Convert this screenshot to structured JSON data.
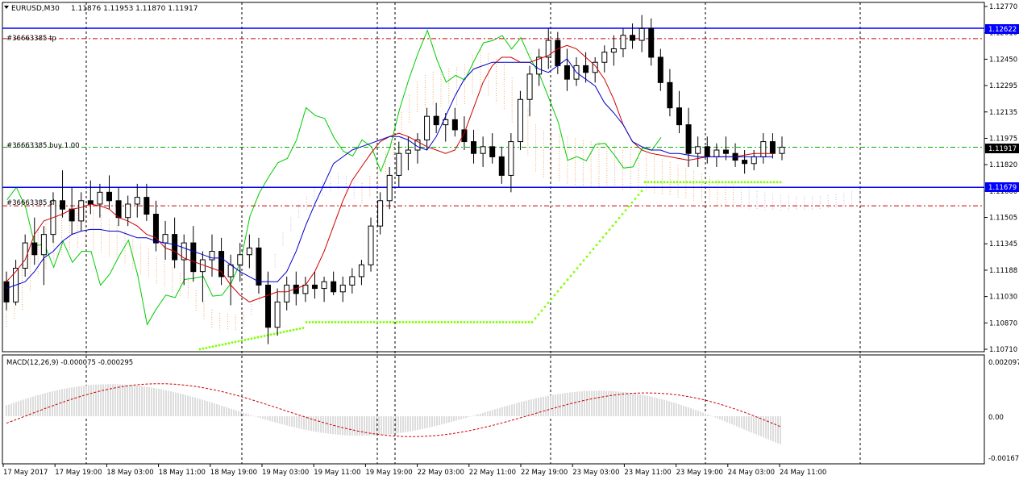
{
  "header": {
    "symbol": "EURUSD,M30",
    "ohlc": "1.11876 1.11953 1.11870 1.11917"
  },
  "macd": {
    "label": "MACD(12,26,9) -0.000075 -0.000295",
    "scale": [
      "0.002097",
      "0.00",
      "-0.001671"
    ]
  },
  "orders": [
    {
      "label": "#36663385 tp",
      "price": 1.1256
    },
    {
      "label": "#36663385 buy 1.00",
      "price": 1.11917
    },
    {
      "label": "#36663385 sl",
      "price": 1.1157
    }
  ],
  "levels": [
    {
      "label": "1.12622",
      "price": 1.12622
    },
    {
      "label": "1.11679",
      "price": 1.11679
    }
  ],
  "current_price": "1.11917",
  "price_scale": [
    "1.12770",
    "1.12610",
    "1.12450",
    "1.12295",
    "1.12135",
    "1.11975",
    "1.11820",
    "1.11660",
    "1.11505",
    "1.11345",
    "1.11188",
    "1.11030",
    "1.10870",
    "1.10710"
  ],
  "time_scale": [
    "17 May 2017",
    "17 May 19:00",
    "18 May 03:00",
    "18 May 11:00",
    "18 May 19:00",
    "19 May 03:00",
    "19 May 11:00",
    "19 May 19:00",
    "22 May 03:00",
    "22 May 11:00",
    "22 May 19:00",
    "23 May 03:00",
    "23 May 11:00",
    "23 May 19:00",
    "24 May 03:00",
    "24 May 11:00"
  ],
  "colors": {
    "bull": "#006400",
    "bear": "#000000",
    "tenkan": "#cc0000",
    "kijun": "#0000cc",
    "chikou": "#00cc00",
    "cloud_a": "#f4a460",
    "cloud_b": "#c8b4dc",
    "sar": "#7fff00",
    "level": "#0000ff",
    "order": "#cc0000",
    "buy": "#00aa00"
  },
  "chart_data": {
    "type": "candlestick",
    "price_range": [
      1.1071,
      1.1277
    ],
    "candles": [
      [
        1.1112,
        1.1118,
        1.1095,
        1.11
      ],
      [
        1.11,
        1.1125,
        1.1098,
        1.112
      ],
      [
        1.112,
        1.114,
        1.1115,
        1.1135
      ],
      [
        1.1135,
        1.115,
        1.1122,
        1.1128
      ],
      [
        1.1128,
        1.1145,
        1.111,
        1.114
      ],
      [
        1.114,
        1.1165,
        1.1135,
        1.116
      ],
      [
        1.116,
        1.1178,
        1.115,
        1.1155
      ],
      [
        1.1155,
        1.1168,
        1.114,
        1.1148
      ],
      [
        1.1148,
        1.1165,
        1.1142,
        1.116
      ],
      [
        1.116,
        1.1172,
        1.1152,
        1.1158
      ],
      [
        1.1158,
        1.117,
        1.115,
        1.1165
      ],
      [
        1.1165,
        1.1175,
        1.1155,
        1.116
      ],
      [
        1.116,
        1.1168,
        1.1145,
        1.115
      ],
      [
        1.115,
        1.1163,
        1.1145,
        1.1158
      ],
      [
        1.1158,
        1.117,
        1.115,
        1.1162
      ],
      [
        1.1162,
        1.117,
        1.1148,
        1.1152
      ],
      [
        1.1152,
        1.116,
        1.113,
        1.1135
      ],
      [
        1.1135,
        1.1148,
        1.1125,
        1.114
      ],
      [
        1.114,
        1.115,
        1.112,
        1.1125
      ],
      [
        1.1125,
        1.114,
        1.111,
        1.1135
      ],
      [
        1.1135,
        1.1145,
        1.1112,
        1.1118
      ],
      [
        1.1118,
        1.113,
        1.11,
        1.1125
      ],
      [
        1.1125,
        1.114,
        1.1115,
        1.113
      ],
      [
        1.113,
        1.1138,
        1.111,
        1.1115
      ],
      [
        1.1115,
        1.1128,
        1.1098,
        1.1122
      ],
      [
        1.1122,
        1.1135,
        1.1112,
        1.1128
      ],
      [
        1.1128,
        1.114,
        1.112,
        1.1132
      ],
      [
        1.1132,
        1.1138,
        1.1105,
        1.111
      ],
      [
        1.111,
        1.1118,
        1.1075,
        1.1085
      ],
      [
        1.1085,
        1.1108,
        1.108,
        1.11
      ],
      [
        1.11,
        1.1115,
        1.1095,
        1.111
      ],
      [
        1.111,
        1.1118,
        1.1098,
        1.1105
      ],
      [
        1.1105,
        1.1115,
        1.11,
        1.111
      ],
      [
        1.111,
        1.1118,
        1.1102,
        1.1108
      ],
      [
        1.1108,
        1.1115,
        1.11,
        1.1112
      ],
      [
        1.1112,
        1.1118,
        1.1104,
        1.1106
      ],
      [
        1.1106,
        1.1115,
        1.11,
        1.111
      ],
      [
        1.111,
        1.112,
        1.1105,
        1.1115
      ],
      [
        1.1115,
        1.1125,
        1.111,
        1.1122
      ],
      [
        1.1122,
        1.115,
        1.1118,
        1.1145
      ],
      [
        1.1145,
        1.1165,
        1.114,
        1.116
      ],
      [
        1.116,
        1.118,
        1.1155,
        1.1175
      ],
      [
        1.1175,
        1.1195,
        1.1168,
        1.1188
      ],
      [
        1.1188,
        1.1198,
        1.1178,
        1.119
      ],
      [
        1.119,
        1.12,
        1.1182,
        1.1196
      ],
      [
        1.1196,
        1.1215,
        1.119,
        1.121
      ],
      [
        1.121,
        1.1218,
        1.12,
        1.1205
      ],
      [
        1.1205,
        1.1212,
        1.1195,
        1.1208
      ],
      [
        1.1208,
        1.1215,
        1.1198,
        1.1202
      ],
      [
        1.1202,
        1.121,
        1.119,
        1.1195
      ],
      [
        1.1195,
        1.1202,
        1.1182,
        1.1188
      ],
      [
        1.1188,
        1.1198,
        1.118,
        1.1192
      ],
      [
        1.1192,
        1.12,
        1.1182,
        1.1186
      ],
      [
        1.1186,
        1.1192,
        1.117,
        1.1175
      ],
      [
        1.1175,
        1.12,
        1.1165,
        1.1195
      ],
      [
        1.1195,
        1.1225,
        1.119,
        1.122
      ],
      [
        1.122,
        1.124,
        1.121,
        1.1235
      ],
      [
        1.1235,
        1.125,
        1.1228,
        1.1245
      ],
      [
        1.1245,
        1.1262,
        1.1238,
        1.1255
      ],
      [
        1.1255,
        1.126,
        1.1235,
        1.124
      ],
      [
        1.124,
        1.125,
        1.1225,
        1.1232
      ],
      [
        1.1232,
        1.1245,
        1.1228,
        1.124
      ],
      [
        1.124,
        1.1248,
        1.123,
        1.1236
      ],
      [
        1.1236,
        1.1245,
        1.123,
        1.1242
      ],
      [
        1.1242,
        1.1252,
        1.1236,
        1.1248
      ],
      [
        1.1248,
        1.1258,
        1.124,
        1.125
      ],
      [
        1.125,
        1.1262,
        1.1245,
        1.1258
      ],
      [
        1.1258,
        1.1265,
        1.125,
        1.1255
      ],
      [
        1.1255,
        1.127,
        1.1248,
        1.1262
      ],
      [
        1.1262,
        1.1268,
        1.124,
        1.1245
      ],
      [
        1.1245,
        1.125,
        1.1225,
        1.123
      ],
      [
        1.123,
        1.1238,
        1.121,
        1.1215
      ],
      [
        1.1215,
        1.1225,
        1.12,
        1.1205
      ],
      [
        1.1205,
        1.1215,
        1.118,
        1.1188
      ],
      [
        1.1188,
        1.1198,
        1.118,
        1.1192
      ],
      [
        1.1192,
        1.1198,
        1.1182,
        1.1186
      ],
      [
        1.1186,
        1.1194,
        1.118,
        1.119
      ],
      [
        1.119,
        1.1198,
        1.1184,
        1.1188
      ],
      [
        1.1188,
        1.1194,
        1.118,
        1.1184
      ],
      [
        1.1184,
        1.119,
        1.1176,
        1.1182
      ],
      [
        1.1182,
        1.119,
        1.1178,
        1.1186
      ],
      [
        1.1186,
        1.12,
        1.1182,
        1.1195
      ],
      [
        1.1195,
        1.12,
        1.1185,
        1.1188
      ],
      [
        1.1188,
        1.1198,
        1.1184,
        1.11917
      ]
    ],
    "tenkan": [
      1.1112,
      1.1118,
      1.1125,
      1.114,
      1.1148,
      1.115,
      1.1152,
      1.1155,
      1.1156,
      1.1158,
      1.1157,
      1.1155,
      1.115,
      1.1148,
      1.1145,
      1.114,
      1.1138,
      1.1132,
      1.113,
      1.1126,
      1.1124,
      1.1122,
      1.112,
      1.1118,
      1.111,
      1.1104,
      1.11,
      1.1102,
      1.1104,
      1.1106,
      1.1106,
      1.1108,
      1.111,
      1.1118,
      1.113,
      1.1145,
      1.116,
      1.1172,
      1.118,
      1.1188,
      1.1195,
      1.1198,
      1.12,
      1.1198,
      1.1195,
      1.1192,
      1.119,
      1.1188,
      1.119,
      1.12,
      1.1215,
      1.123,
      1.124,
      1.1245,
      1.1245,
      1.1242,
      1.1242,
      1.1244,
      1.1246,
      1.125,
      1.1252,
      1.125,
      1.1245,
      1.124,
      1.1232,
      1.122,
      1.1205,
      1.1195,
      1.119,
      1.1188,
      1.1187,
      1.1186,
      1.1185,
      1.1184,
      1.1185,
      1.1186,
      1.1186,
      1.1186,
      1.1186,
      1.1187,
      1.1188,
      1.1188,
      1.1188
    ],
    "kijun": [
      1.1108,
      1.111,
      1.1112,
      1.1118,
      1.1126,
      1.113,
      1.1136,
      1.114,
      1.1142,
      1.1143,
      1.1143,
      1.1142,
      1.1142,
      1.114,
      1.1138,
      1.1138,
      1.1136,
      1.1135,
      1.1134,
      1.1132,
      1.113,
      1.1128,
      1.1126,
      1.1126,
      1.1122,
      1.1118,
      1.1115,
      1.1112,
      1.1112,
      1.1112,
      1.1118,
      1.113,
      1.1145,
      1.1158,
      1.117,
      1.1182,
      1.1186,
      1.119,
      1.1192,
      1.1194,
      1.1196,
      1.1198,
      1.1198,
      1.1196,
      1.1192,
      1.119,
      1.1198,
      1.121,
      1.1222,
      1.1232,
      1.1238,
      1.124,
      1.1242,
      1.1242,
      1.1242,
      1.1242,
      1.1242,
      1.1238,
      1.1236,
      1.124,
      1.1244,
      1.1236,
      1.1232,
      1.1228,
      1.1218,
      1.1212,
      1.1205,
      1.1195,
      1.1192,
      1.119,
      1.119,
      1.1188,
      1.1188,
      1.1187,
      1.1186,
      1.1186,
      1.1186,
      1.1186,
      1.1186,
      1.1186,
      1.1186,
      1.1186,
      1.1186
    ]
  }
}
